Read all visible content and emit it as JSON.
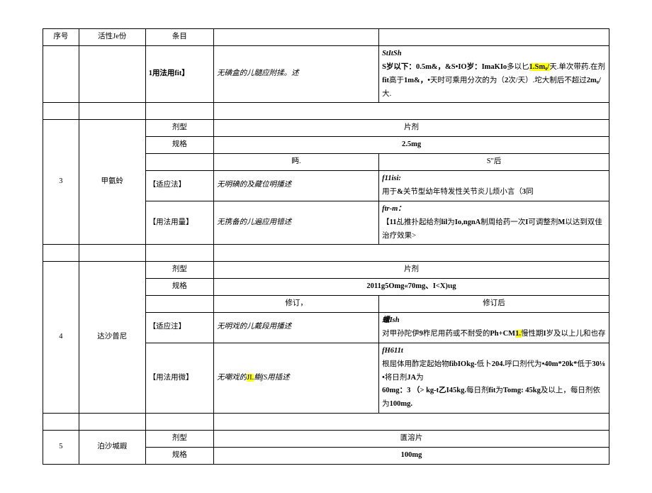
{
  "header": {
    "col_seq": "序号",
    "col_active": "活性Je份",
    "col_item": "条目"
  },
  "row_top": {
    "item": "1用法用fit】",
    "before": "无碘盒的儿髓应附揉。述",
    "after_l1_bi": "StItSh",
    "after_l2_a": "S岁以下：",
    "after_l2_b": "0.5m&，&S•IO岁：ImaKIo",
    "after_l2_c": "多以匕",
    "after_l2_hl": "1.Sm₀/",
    "after_l2_d": "天.单次带药.在剂",
    "after_l2_e": "fit",
    "after_l2_f": "高于",
    "after_l2_g": "1m&，•",
    "after_l2_h": "天时可乘用分次的为（",
    "after_l2_i": "2",
    "after_l2_j": "次/天）.坨大制后不超过",
    "after_l2_k": "2m₀/",
    "after_l2_l": "大."
  },
  "row3": {
    "seq": "3",
    "active": "甲氨蛉",
    "type_label": "剂型",
    "type_value": "片剂",
    "spec_label": "规格",
    "spec_value": "2.5mg",
    "split_before": "眄.",
    "split_after": "S\"后",
    "ind_label": "【适应法】",
    "ind_before": "无明碘的及藏位明播述",
    "ind_after_bi": "f11isi:",
    "ind_after_txt_a": "用于",
    "ind_after_txt_b": "&",
    "ind_after_txt_c": "关节型幼年特发性关节炎儿烦小言（",
    "ind_after_txt_d": "3",
    "ind_after_txt_e": "同",
    "usage_label": "【用法用量】",
    "usage_before": "无携备的儿遍应用错述",
    "usage_after_bi": "ftr-m：",
    "usage_after_l2_a": "【",
    "usage_after_l2_b": "11",
    "usage_after_l2_c": "乩推扑起给剂",
    "usage_after_l2_d": "lil",
    "usage_after_l2_e": "为",
    "usage_after_l2_f": "Io,ngnA",
    "usage_after_l2_g": "制周给药一次",
    "usage_after_l2_h": "I",
    "usage_after_l2_i": "可调整剂",
    "usage_after_l2_j": "M",
    "usage_after_l2_k": "以达到双佳治疗效果>"
  },
  "row4": {
    "seq": "4",
    "active": "达沙普尼",
    "type_label": "剂型",
    "type_value": "片剂",
    "spec_label": "规格",
    "spec_value": "2011g5Omg«70mg、I<X)ιιg",
    "split_before": "修订，",
    "split_after": "修订后",
    "ind_label": "【适应注】",
    "ind_before": "无明戏的儿戴段用播述",
    "ind_after_bi": "蠟Ish",
    "ind_after_txt_a": "对甲孙陀伊",
    "ind_after_txt_b": "9",
    "ind_after_txt_c": "柞尼用药或不耐受的",
    "ind_after_txt_d": "Ph+CM",
    "ind_after_hl": "1.",
    "ind_after_txt_e": "慢性期",
    "ind_after_txt_f": "I",
    "ind_after_txt_g": "岁及以上儿和也存",
    "usage_label": "【用法用微】",
    "usage_before_a": "无嘲戏的",
    "usage_before_hl": "JI.",
    "usage_before_b": "鯯ʃS",
    "usage_before_c": "用插述",
    "usage_after_bi": "fH611t",
    "usage_after_l2_a": "根屈体用酢定起始物",
    "usage_after_l2_b": "fibIOkg-",
    "usage_after_l2_c": "低卜",
    "usage_after_l2_d": "204.",
    "usage_after_l2_e": "呼口剂代为",
    "usage_after_l2_f": "•40m*20k*",
    "usage_after_l2_g": "低于",
    "usage_after_l2_h": "30⅛•",
    "usage_after_l2_i": "将日剂",
    "usage_after_l2_j": "JA",
    "usage_after_l2_k": "为",
    "usage_after_l3_a": "60mg：3 （> kg-t乙I45kg.",
    "usage_after_l3_b": "每日剂",
    "usage_after_l3_c": "fit",
    "usage_after_l3_d": "为",
    "usage_after_l3_e": "Tomg: 45kg",
    "usage_after_l3_f": "及以上，每日剂依为",
    "usage_after_l3_g": "100mg."
  },
  "row5": {
    "seq": "5",
    "active": "泊沙堿嘏",
    "type_label": "剂型",
    "type_value": "匱溶片",
    "spec_label": "规格",
    "spec_value": "100mg"
  }
}
